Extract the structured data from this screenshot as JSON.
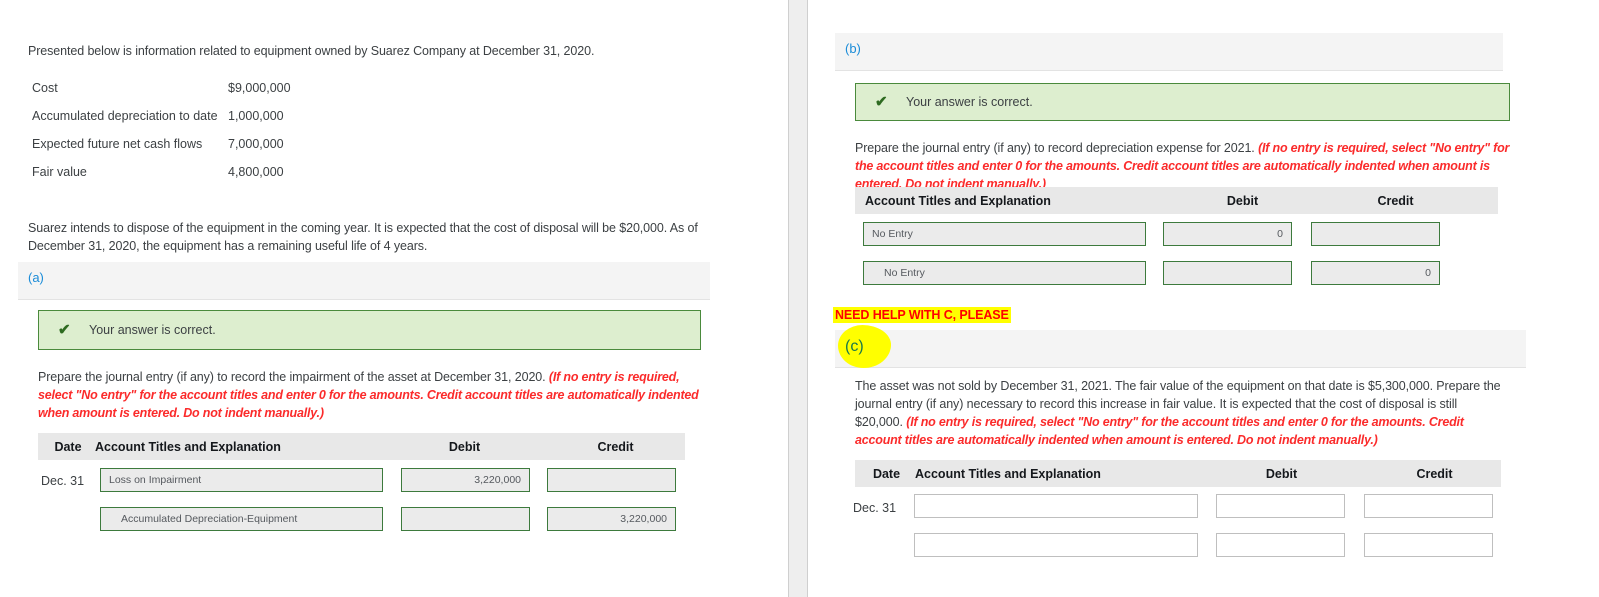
{
  "left_panel": {
    "intro": "Presented below is information related to equipment owned by Suarez Company at December 31, 2020.",
    "facts": [
      {
        "label": "Cost",
        "value": "$9,000,000"
      },
      {
        "label": "Accumulated depreciation to date",
        "value": "1,000,000"
      },
      {
        "label": "Expected future net cash flows",
        "value": "7,000,000"
      },
      {
        "label": "Fair value",
        "value": "4,800,000"
      }
    ],
    "disposal_note": "Suarez intends to dispose of the equipment in the coming year. It is expected that the cost of disposal will be $20,000. As of December 31, 2020, the equipment has a remaining useful life of 4 years.",
    "section_a": {
      "label": "(a)",
      "alert_text": "Your answer is correct.",
      "alert_icon": "check-icon",
      "prompt_normal": "Prepare the journal entry (if any) to record the impairment of the asset at December 31, 2020. ",
      "prompt_italic": "(If no entry is required, select \"No entry\" for the account titles and enter 0 for the amounts. Credit account titles are automatically indented when amount is entered. Do not indent manually.)",
      "table": {
        "headers": {
          "date": "Date",
          "account": "Account Titles and Explanation",
          "debit": "Debit",
          "credit": "Credit"
        },
        "rows": [
          {
            "date": "Dec. 31",
            "account": "Loss on Impairment",
            "indented": false,
            "debit": "3,220,000",
            "credit": ""
          },
          {
            "date": "",
            "account": "Accumulated Depreciation-Equipment",
            "indented": true,
            "debit": "",
            "credit": "3,220,000"
          }
        ]
      }
    }
  },
  "right_panel": {
    "section_b": {
      "label": "(b)",
      "alert_text": "Your answer is correct.",
      "alert_icon": "check-icon",
      "prompt_normal": "Prepare the journal entry (if any) to record depreciation expense for 2021. ",
      "prompt_italic": "(If no entry is required, select \"No entry\" for the account titles and enter 0 for the amounts. Credit account titles are automatically indented when amount is entered. Do not indent manually.)",
      "table": {
        "headers": {
          "account": "Account Titles and Explanation",
          "debit": "Debit",
          "credit": "Credit"
        },
        "rows": [
          {
            "account": "No Entry",
            "indented": false,
            "debit": "0",
            "credit": ""
          },
          {
            "account": "No Entry",
            "indented": true,
            "debit": "",
            "credit": "0"
          }
        ]
      }
    },
    "annotation": "NEED HELP WITH C, PLEASE",
    "section_c": {
      "label": "(c)",
      "prompt_normal": "The asset was not sold by December 31, 2021. The fair value of the equipment on that date is $5,300,000. Prepare the journal entry (if any) necessary to record this increase in fair value. It is expected that the cost of disposal is still $20,000. ",
      "prompt_italic": "(If no entry is required, select \"No entry\" for the account titles and enter 0 for the amounts. Credit account titles are automatically indented when amount is entered. Do not indent manually.)",
      "table": {
        "headers": {
          "date": "Date",
          "account": "Account Titles and Explanation",
          "debit": "Debit",
          "credit": "Credit"
        },
        "rows": [
          {
            "date": "Dec. 31",
            "account": "",
            "debit": "",
            "credit": ""
          },
          {
            "date": "",
            "account": "",
            "debit": "",
            "credit": ""
          }
        ]
      }
    }
  },
  "colors": {
    "section_label": "#1a8cd8",
    "alert_bg": "#ddeecf",
    "alert_border": "#4a8a3c",
    "instruction_red": "#fb2b2b",
    "input_border_filled": "#3d7a3d",
    "input_bg_filled": "#ebebeb",
    "highlight": "#ffff00",
    "table_header_bg": "#e8e8e8"
  }
}
